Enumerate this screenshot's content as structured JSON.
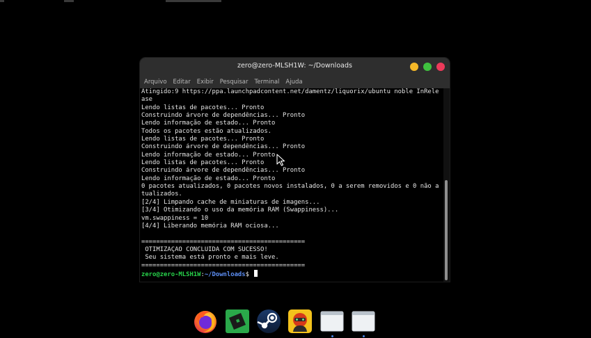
{
  "window": {
    "title": "zero@zero-MLSH1W: ~/Downloads"
  },
  "menu": {
    "items": [
      "Arquivo",
      "Editar",
      "Exibir",
      "Pesquisar",
      "Terminal",
      "Ajuda"
    ]
  },
  "terminal": {
    "lines": [
      "Atingido:9 https://ppa.launchpadcontent.net/damentz/liquorix/ubuntu noble InRele",
      "ase",
      "Lendo listas de pacotes... Pronto",
      "Construindo árvore de dependências... Pronto",
      "Lendo informação de estado... Pronto",
      "Todos os pacotes estão atualizados.",
      "Lendo listas de pacotes... Pronto",
      "Construindo árvore de dependências... Pronto",
      "Lendo informação de estado... Pronto",
      "Lendo listas de pacotes... Pronto",
      "Construindo árvore de dependências... Pronto",
      "Lendo informação de estado... Pronto",
      "0 pacotes atualizados, 0 pacotes novos instalados, 0 a serem removidos e 0 não a",
      "tualizados.",
      "[2/4] Limpando cache de miniaturas de imagens...",
      "[3/4] Otimizando o uso da memória RAM (Swappiness)...",
      "vm.swappiness = 10",
      "[4/4] Liberando memória RAM ociosa...",
      "",
      "============================================",
      " OTIMIZAÇÃO CONCLUÍDA COM SUCESSO!",
      " Seu sistema está pronto e mais leve.",
      "============================================"
    ],
    "prompt": {
      "user_host": "zero@zero-MLSH1W",
      "separator": ":",
      "path": "~/Downloads",
      "symbol": "$ "
    }
  },
  "dock": {
    "items": [
      {
        "name": "firefox",
        "icon": "firefox-icon",
        "running": false
      },
      {
        "name": "roblox",
        "icon": "roblox-icon",
        "running": false
      },
      {
        "name": "steam",
        "icon": "steam-icon",
        "running": false
      },
      {
        "name": "game-app",
        "icon": "game-character-icon",
        "running": false
      },
      {
        "name": "window-1",
        "icon": "generic-window-icon",
        "running": true
      },
      {
        "name": "window-2",
        "icon": "generic-window-icon",
        "running": true
      }
    ]
  },
  "colors": {
    "terminal_bg": "#000000",
    "titlebar_bg": "#2e2e2e",
    "prompt_user": "#27d14a",
    "prompt_path": "#5d8ff5",
    "btn_minimize": "#f5b828",
    "btn_maximize": "#3fc13f",
    "btn_close": "#ec3a5a"
  }
}
